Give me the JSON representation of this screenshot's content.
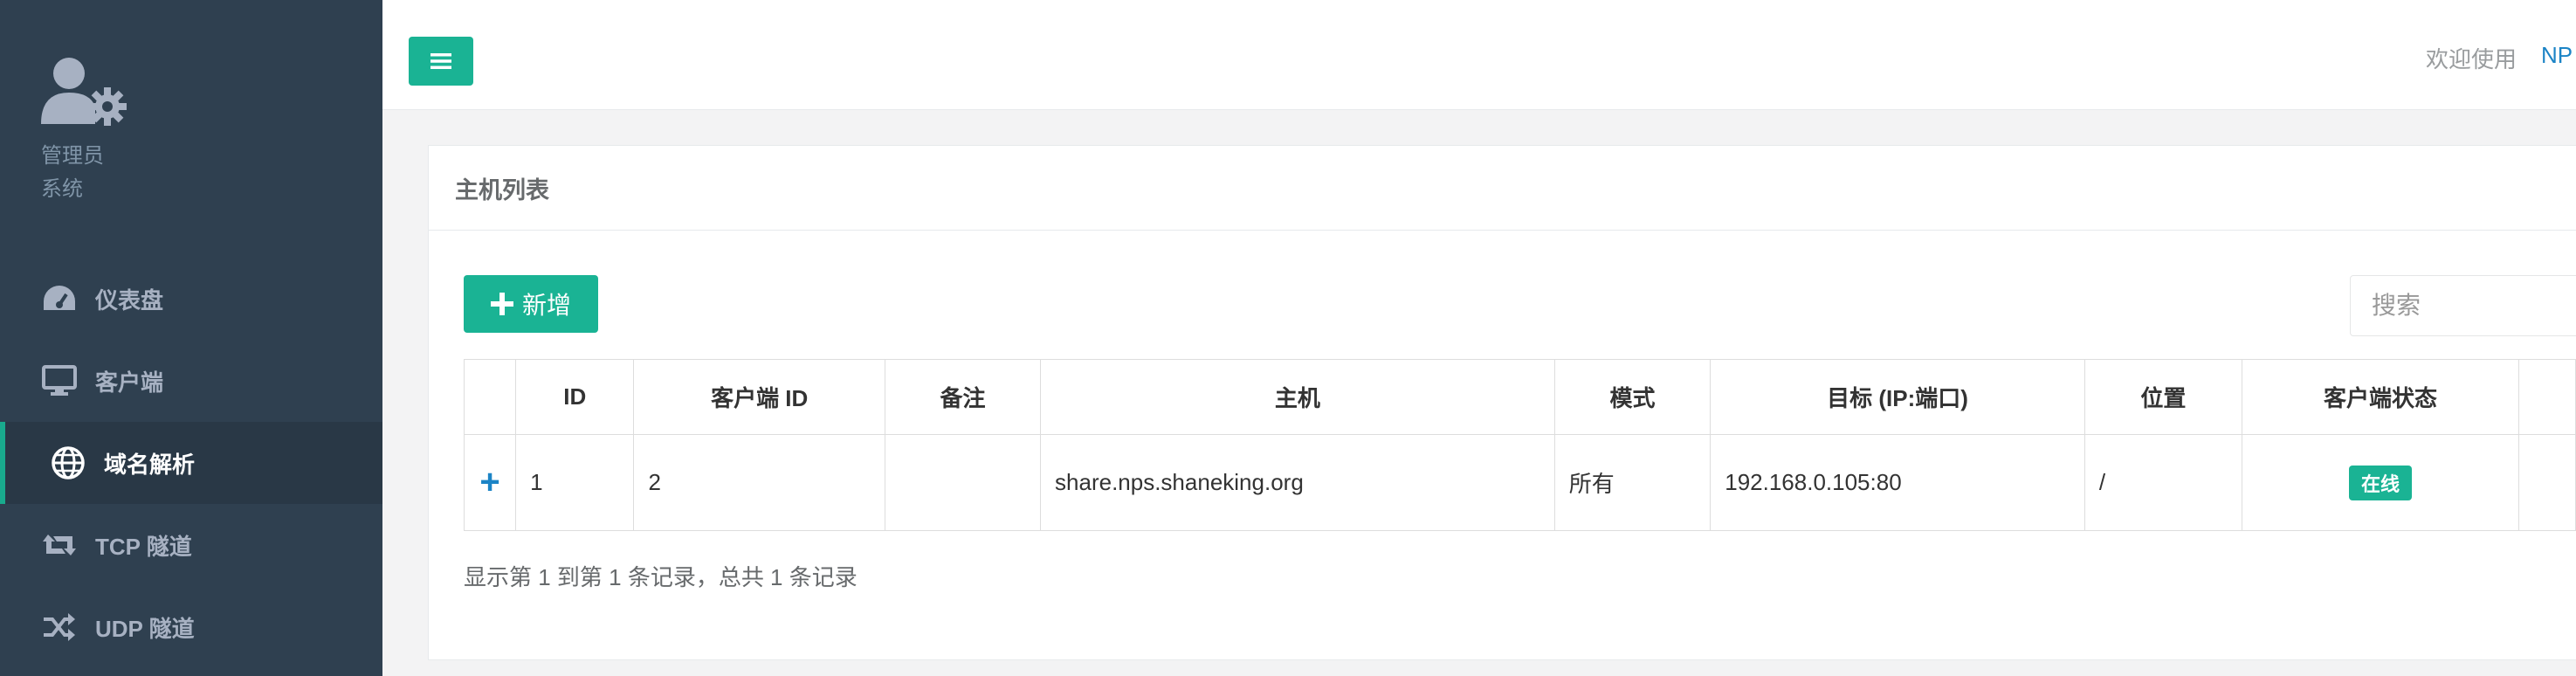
{
  "sidebar": {
    "profile": {
      "line1": "管理员",
      "line2": "系统"
    },
    "items": [
      {
        "label": "仪表盘",
        "icon": "dashboard-icon"
      },
      {
        "label": "客户端",
        "icon": "desktop-icon"
      },
      {
        "label": "域名解析",
        "icon": "globe-icon"
      },
      {
        "label": "TCP 隧道",
        "icon": "retweet-icon"
      },
      {
        "label": "UDP 隧道",
        "icon": "random-icon"
      }
    ]
  },
  "topbar": {
    "welcome": "欢迎使用",
    "brand": "NP"
  },
  "panel": {
    "title": "主机列表",
    "add_label": "新增",
    "search_placeholder": "搜索",
    "columns": [
      "",
      "ID",
      "客户端 ID",
      "备注",
      "主机",
      "模式",
      "目标 (IP:端口)",
      "位置",
      "客户端状态"
    ],
    "rows": [
      {
        "expand": "+",
        "id": "1",
        "client_id": "2",
        "remark": "",
        "host": "share.nps.shaneking.org",
        "mode": "所有",
        "target": "192.168.0.105:80",
        "location": "/",
        "status": "在线"
      }
    ],
    "pagination": "显示第 1 到第 1 条记录，总共 1 条记录"
  },
  "colors": {
    "sidebar": "#2f4050",
    "accent": "#1ab394",
    "link": "#1c84c6"
  }
}
